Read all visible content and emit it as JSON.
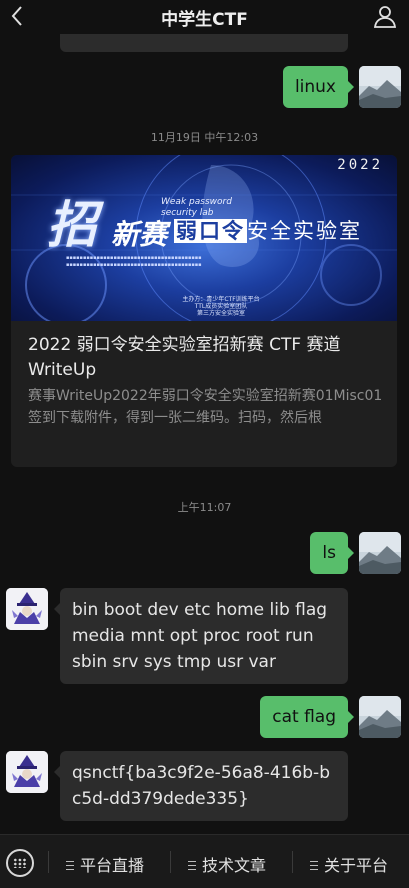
{
  "header": {
    "title": "中学生CTF"
  },
  "messages": [
    {
      "from": "me",
      "text": "linux"
    },
    {
      "time": "11月19日 中午12:03"
    },
    {
      "card": {
        "title": "2022 弱口令安全实验室招新赛 CTF 赛道 WriteUp",
        "desc": "赛事WriteUp2022年弱口令安全实验室招新赛01Misc01签到下载附件，得到一张二维码。扫码，然后根",
        "image": {
          "year": "2022",
          "sub1": "Weak password",
          "sub2": "security lab",
          "big": "招",
          "xinsai": "新赛",
          "lab_box": "弱口令",
          "lab_rest": "安全实验室",
          "footer1": "主办方：青少年CTF训练平台",
          "footer2": "TTL成员实验室团队",
          "footer3": "第三方安全实验室"
        }
      }
    },
    {
      "time": "上午11:07"
    },
    {
      "from": "me",
      "text": "ls"
    },
    {
      "from": "bot",
      "text": "bin boot dev etc home lib flag media mnt opt proc root run sbin srv sys tmp usr var"
    },
    {
      "from": "me",
      "text": "cat flag"
    },
    {
      "from": "bot",
      "text": "qsnctf{ba3c9f2e-56a8-416b-bc5d-dd379dede335}"
    }
  ],
  "menu": {
    "items": [
      {
        "label": "平台直播"
      },
      {
        "label": "技术文章"
      },
      {
        "label": "关于平台"
      }
    ]
  },
  "icons": {
    "back": "back-chevron-icon",
    "profile": "person-icon",
    "keyboard": "keyboard-icon",
    "menu": "hamburger-icon"
  },
  "colors": {
    "background": "#111111",
    "my_bubble": "#58be6b",
    "other_bubble": "#2c2c2c",
    "card": "#1f1f1f"
  }
}
